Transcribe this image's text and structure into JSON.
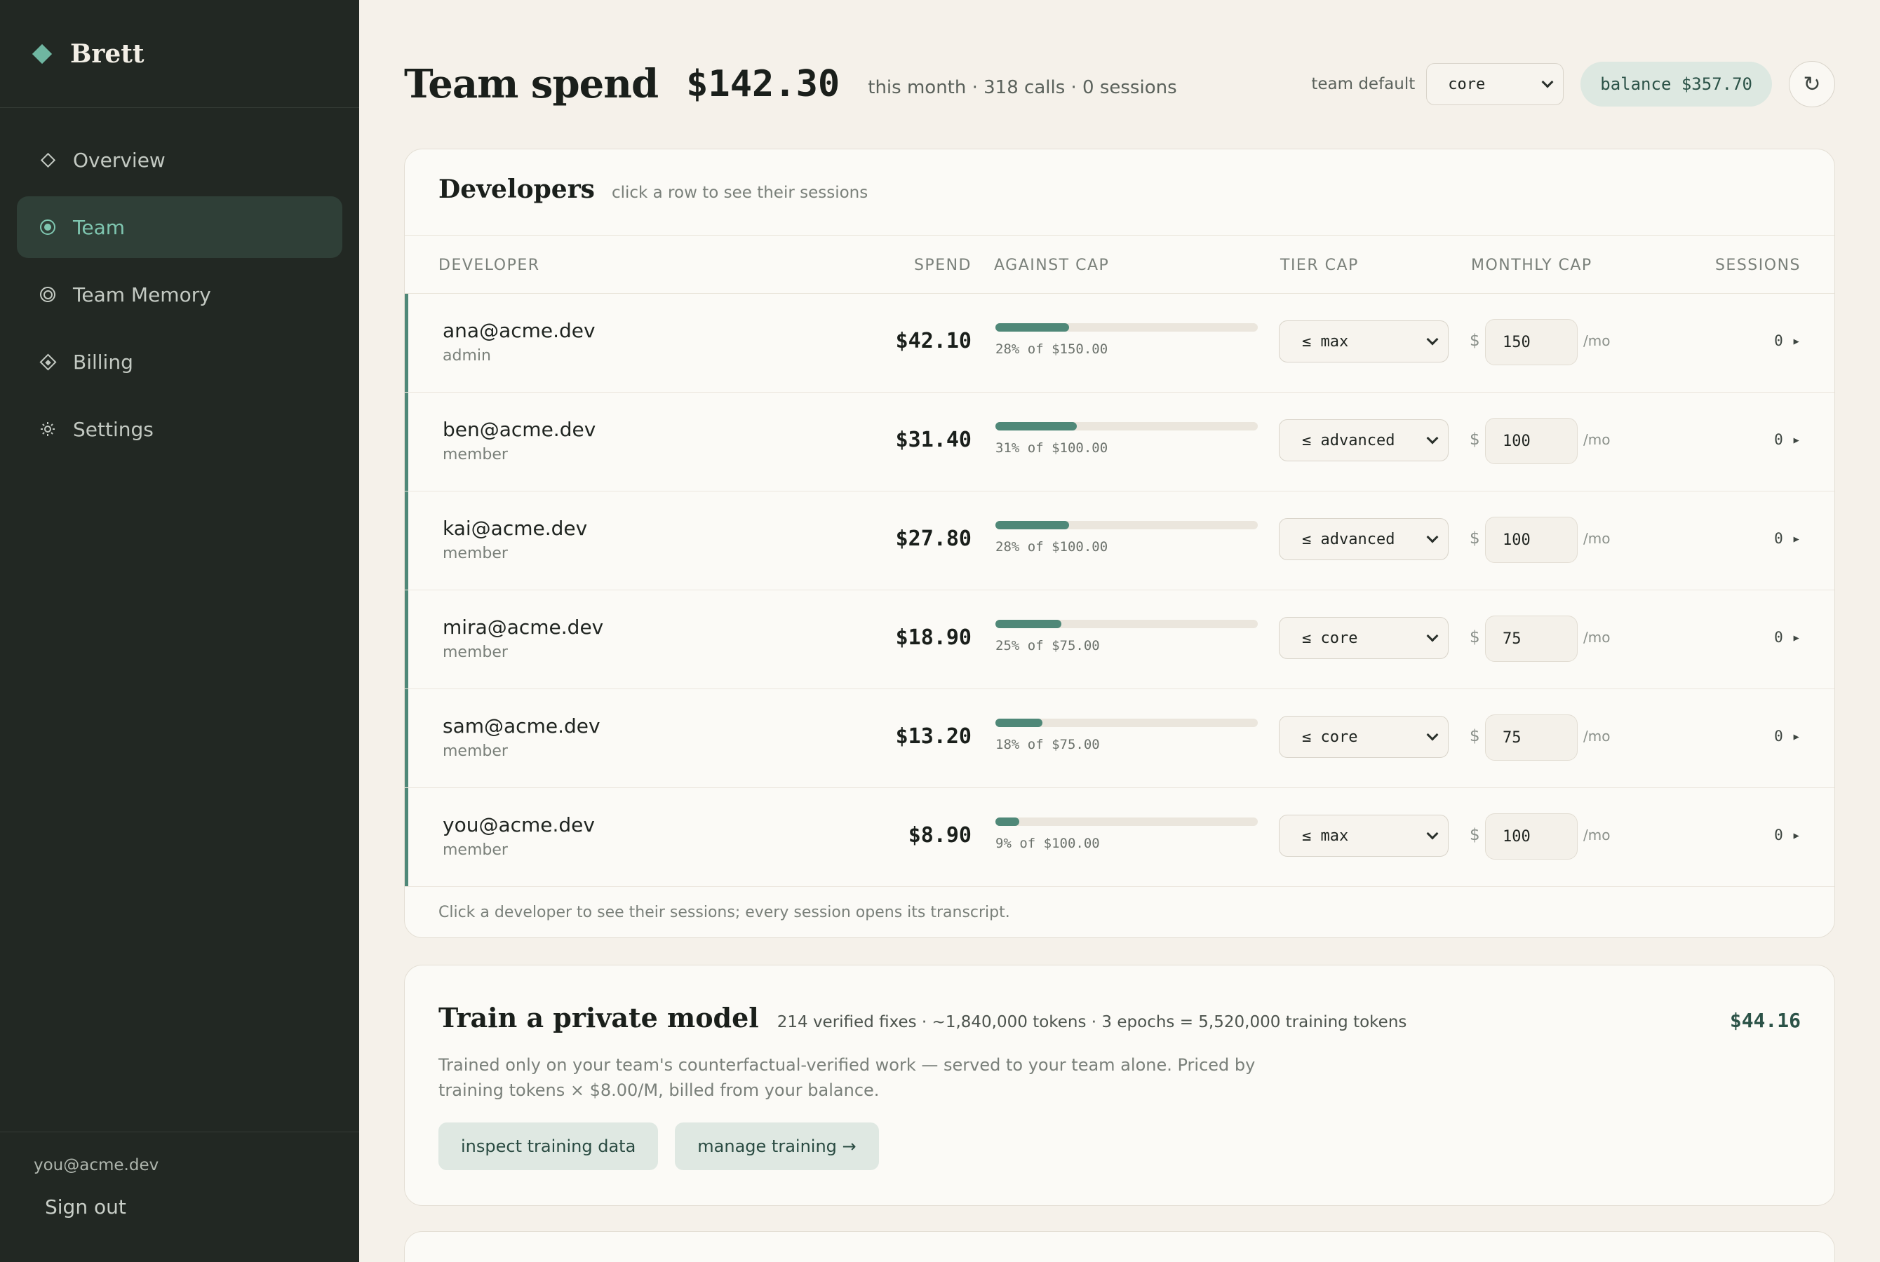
{
  "sidebar": {
    "brand": "Brett",
    "nav": [
      {
        "label": "Overview",
        "icon": "diamond-icon"
      },
      {
        "label": "Team",
        "icon": "radio-dot-icon",
        "active": true
      },
      {
        "label": "Team Memory",
        "icon": "ring-icon"
      },
      {
        "label": "Billing",
        "icon": "billing-diamond-icon"
      },
      {
        "label": "Settings",
        "icon": "gear-icon"
      }
    ],
    "user_email": "you@acme.dev",
    "sign_out": "Sign out"
  },
  "header": {
    "title": "Team spend",
    "total": "$142.30",
    "meta": "this month · 318 calls · 0 sessions",
    "team_default_label": "team default",
    "team_default_value": "core",
    "balance": "balance $357.70",
    "refresh_glyph": "↻"
  },
  "developers": {
    "title": "Developers",
    "subtitle": "click a row to see their sessions",
    "columns": [
      "DEVELOPER",
      "SPEND",
      "AGAINST CAP",
      "TIER CAP",
      "MONTHLY CAP",
      "SESSIONS"
    ],
    "rows": [
      {
        "email": "ana@acme.dev",
        "role": "admin",
        "spend": "$42.10",
        "pct": 28,
        "cap_label": "28% of $150.00",
        "tier": "≤ max",
        "cap": "150",
        "per": "/mo",
        "sessions": "0 ▸"
      },
      {
        "email": "ben@acme.dev",
        "role": "member",
        "spend": "$31.40",
        "pct": 31,
        "cap_label": "31% of $100.00",
        "tier": "≤ advanced",
        "cap": "100",
        "per": "/mo",
        "sessions": "0 ▸"
      },
      {
        "email": "kai@acme.dev",
        "role": "member",
        "spend": "$27.80",
        "pct": 28,
        "cap_label": "28% of $100.00",
        "tier": "≤ advanced",
        "cap": "100",
        "per": "/mo",
        "sessions": "0 ▸"
      },
      {
        "email": "mira@acme.dev",
        "role": "member",
        "spend": "$18.90",
        "pct": 25,
        "cap_label": "25% of $75.00",
        "tier": "≤ core",
        "cap": "75",
        "per": "/mo",
        "sessions": "0 ▸"
      },
      {
        "email": "sam@acme.dev",
        "role": "member",
        "spend": "$13.20",
        "pct": 18,
        "cap_label": "18% of $75.00",
        "tier": "≤ core",
        "cap": "75",
        "per": "/mo",
        "sessions": "0 ▸"
      },
      {
        "email": "you@acme.dev",
        "role": "member",
        "spend": "$8.90",
        "pct": 9,
        "cap_label": "9% of $100.00",
        "tier": "≤ max",
        "cap": "100",
        "per": "/mo",
        "sessions": "0 ▸"
      }
    ],
    "currency_symbol": "$",
    "footnote": "Click a developer to see their sessions; every session opens its transcript."
  },
  "training": {
    "title": "Train a private model",
    "stats": "214 verified fixes · ~1,840,000 tokens · 3 epochs = 5,520,000 training tokens",
    "price": "$44.16",
    "description": "Trained only on your team's counterfactual-verified work — served to your team alone. Priced by training tokens × $8.00/M, billed from your balance.",
    "buttons": [
      "inspect training data",
      "manage training →"
    ]
  },
  "colors": {
    "sidebar_bg": "#222823",
    "accent": "#4f8878",
    "accent_light": "#7fc6b0",
    "page_bg": "#f5f1ea",
    "card_bg": "#fbfaf6"
  }
}
